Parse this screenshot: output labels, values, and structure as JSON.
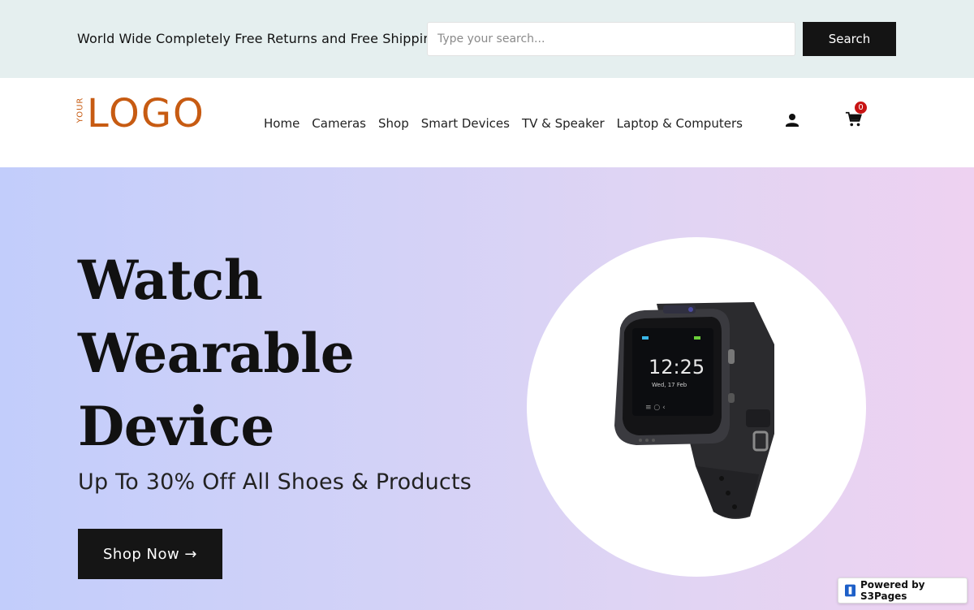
{
  "topbar": {
    "message": "World Wide Completely Free Returns and Free Shipping",
    "search_placeholder": "Type your search...",
    "search_label": "Search"
  },
  "logo": {
    "small": "YOUR",
    "big": "LOGO"
  },
  "nav": {
    "items": [
      {
        "label": "Home"
      },
      {
        "label": "Cameras"
      },
      {
        "label": "Shop"
      },
      {
        "label": "Smart Devices"
      },
      {
        "label": "TV & Speaker"
      },
      {
        "label": "Laptop & Computers"
      }
    ]
  },
  "header_icons": {
    "user": "user-icon",
    "cart": "cart-icon",
    "cart_count": "0"
  },
  "hero": {
    "title_lines": [
      "Watch",
      "Wearable",
      "Device"
    ],
    "subtitle": "Up To 30% Off All Shoes & Products",
    "cta_label": "Shop Now →",
    "watch_time": "12:25",
    "watch_date": "Wed, 17 Feb"
  },
  "powered_by": "Powered by S3Pages",
  "colors": {
    "brand": "#c75b12",
    "topbar_bg": "#e5efef",
    "button_dark": "#141414",
    "badge": "#c81414"
  }
}
